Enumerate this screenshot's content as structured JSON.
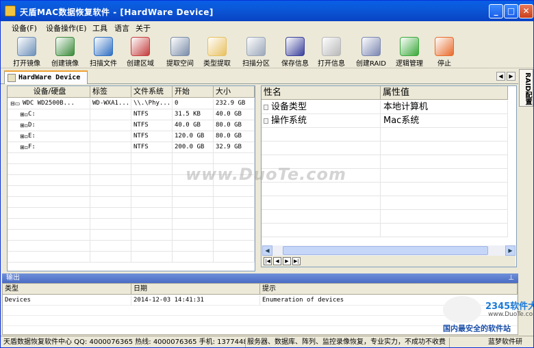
{
  "window": {
    "title": "天盾MAC数据恢复软件 - [HardWare Device]"
  },
  "menu": [
    "设备(F)",
    "设备操作(E)",
    "工具",
    "语言",
    "关于"
  ],
  "toolbar": [
    {
      "label": "打开镜像",
      "icon": "disk-icon",
      "color": "#6b8fb8"
    },
    {
      "label": "创建镜像",
      "icon": "monitor-icon",
      "color": "#3a8a3a"
    },
    {
      "label": "扫描文件",
      "icon": "scan-icon",
      "color": "#2f6fc2"
    },
    {
      "label": "创建区域",
      "icon": "region-icon",
      "color": "#c43c3c"
    },
    {
      "label": "提取空间",
      "icon": "extract-icon",
      "color": "#7a8ca8"
    },
    {
      "label": "类型提取",
      "icon": "document-icon",
      "color": "#e8c060"
    },
    {
      "label": "扫描分区",
      "icon": "partition-icon",
      "color": "#9aa6b8"
    },
    {
      "label": "保存信息",
      "icon": "floppy-icon",
      "color": "#3a3f9a"
    },
    {
      "label": "打开信息",
      "icon": "eraser-icon",
      "color": "#b8b8b8"
    },
    {
      "label": "创建RAID",
      "icon": "raid-icon",
      "color": "#7a86b0"
    },
    {
      "label": "逻辑管理",
      "icon": "recycle-icon",
      "color": "#3aa83a"
    },
    {
      "label": "停止",
      "icon": "pause-icon",
      "color": "#e86a2a"
    }
  ],
  "tab": {
    "label": "HardWare Device"
  },
  "sidetab": "RAID配置",
  "device_table": {
    "columns": [
      "设备/硬盘",
      "标签",
      "文件系统",
      "开始",
      "大小"
    ],
    "rows": [
      {
        "name": "WDC WD2500B...",
        "label": "WD-WXA1...",
        "fs": "\\\\.\\Phy...",
        "start": "0",
        "size": "232.9 GB"
      },
      {
        "name": "C:",
        "label": "",
        "fs": "NTFS",
        "start": "31.5 KB",
        "size": "40.0 GB"
      },
      {
        "name": "D:",
        "label": "",
        "fs": "NTFS",
        "start": "40.0 GB",
        "size": "80.0 GB"
      },
      {
        "name": "E:",
        "label": "",
        "fs": "NTFS",
        "start": "120.0 GB",
        "size": "80.0 GB"
      },
      {
        "name": "F:",
        "label": "",
        "fs": "NTFS",
        "start": "200.0 GB",
        "size": "32.9 GB"
      }
    ]
  },
  "properties": {
    "columns": [
      "性名",
      "属性值"
    ],
    "rows": [
      {
        "name": "设备类型",
        "value": "本地计算机"
      },
      {
        "name": "操作系统",
        "value": "Mac系统"
      }
    ]
  },
  "output": {
    "title": "输出",
    "columns": [
      "类型",
      "日期",
      "提示"
    ],
    "rows": [
      {
        "type": "Devices",
        "date": "2014-12-03 14:41:31",
        "msg": "Enumeration of devices"
      }
    ]
  },
  "status": {
    "left": "天盾数据恢复软件中心 QQ: 4000076365 热线: 4000076365 手机: 1377448",
    "mid": "服务器、数据库、阵列、监控录像恢复，专业实力，不成功不收费",
    "right": "蓝梦软件研"
  },
  "watermark": "www.DuoTe.com",
  "logo": {
    "title": "2345软件大全",
    "url": "www.DuoTe.com",
    "slogan": "国内最安全的软件站"
  }
}
